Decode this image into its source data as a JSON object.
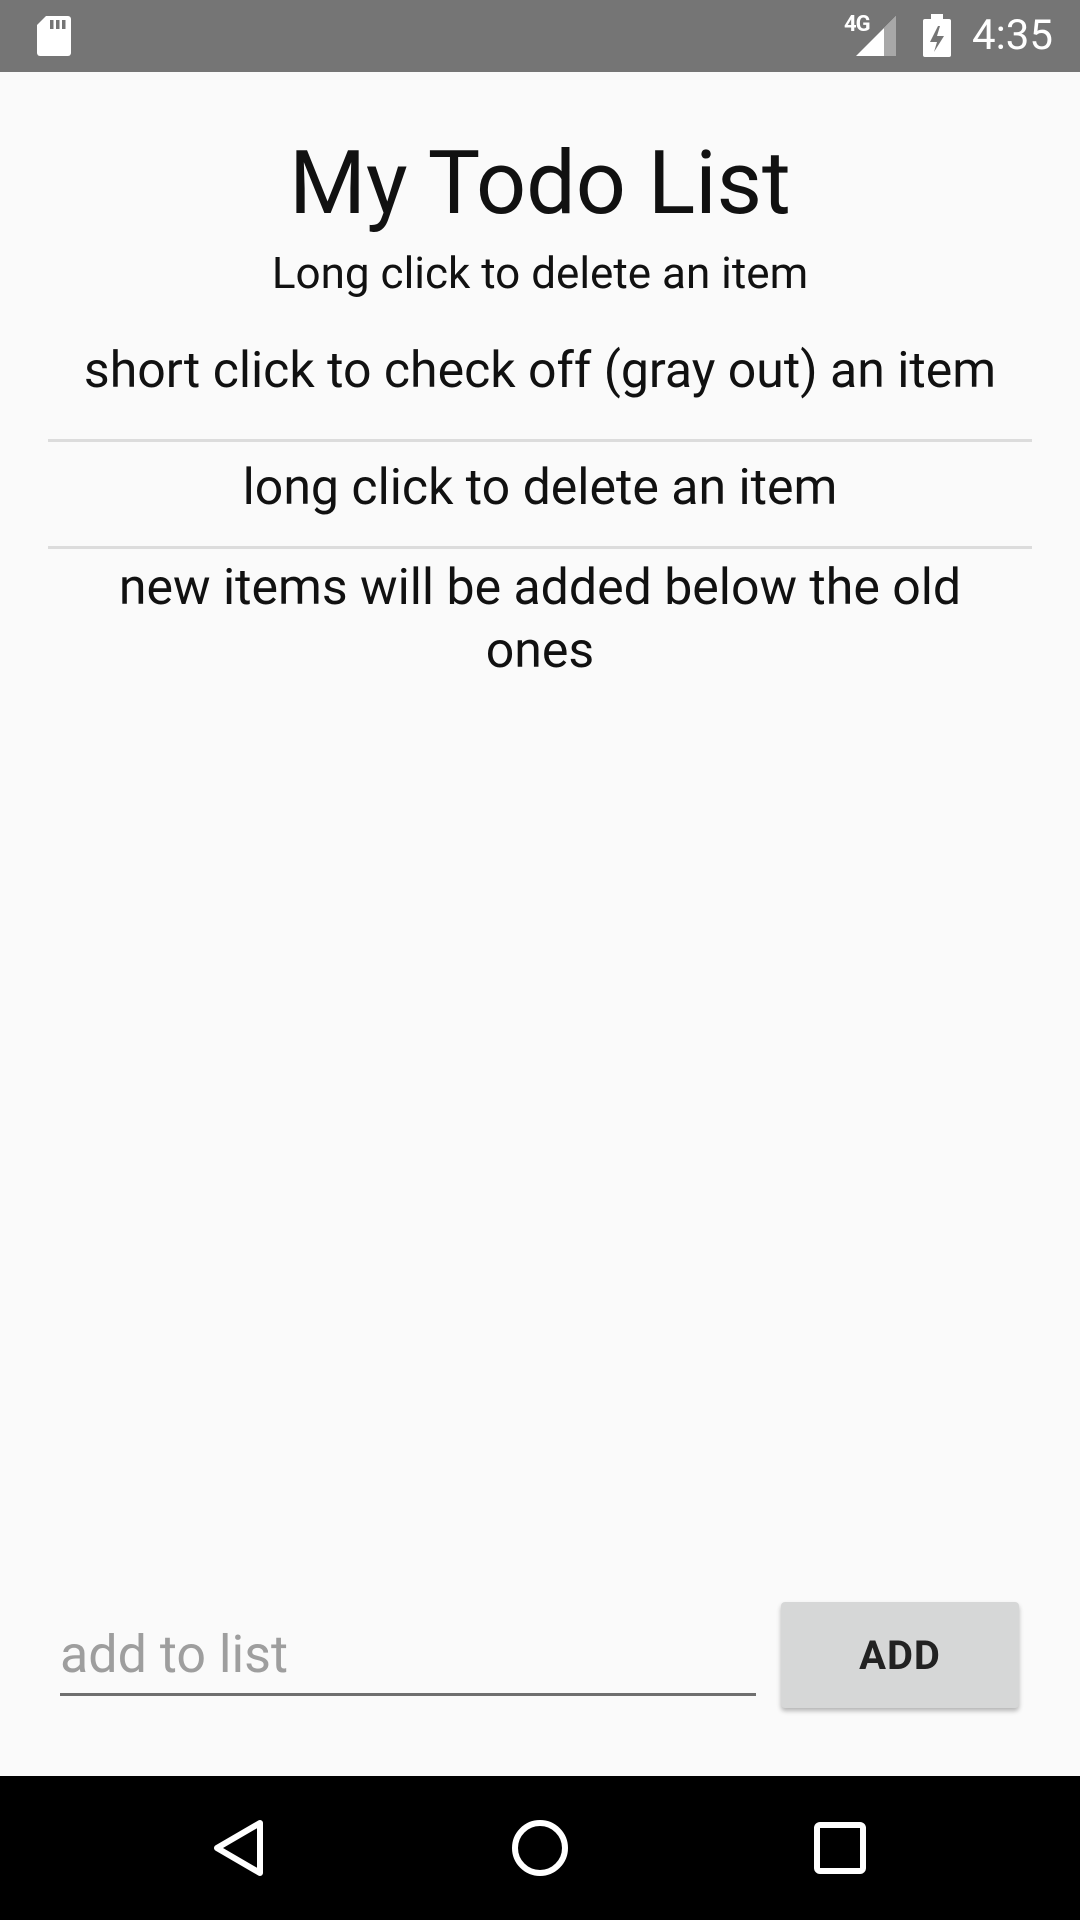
{
  "status_bar": {
    "network_type": "4G",
    "time": "4:35",
    "icons": [
      "sd-card-icon",
      "signal-icon",
      "battery-charging-icon"
    ]
  },
  "app": {
    "title": "My Todo List",
    "subtitle": "Long click to delete an item"
  },
  "todo_items": [
    {
      "text": "short click to check off (gray out) an item"
    },
    {
      "text": "long click to delete an item"
    },
    {
      "text": "new items will be added below the old ones"
    }
  ],
  "add_input": {
    "value": "",
    "placeholder": "add to list"
  },
  "add_button": {
    "label": "ADD"
  },
  "nav_bar": {
    "icons": [
      "back-icon",
      "home-icon",
      "recents-icon"
    ]
  },
  "colors": {
    "status_bar": "#757575",
    "background": "#fafafa",
    "divider": "#dcdcdc",
    "button": "#d6d7d7",
    "nav_bar": "#000000"
  }
}
